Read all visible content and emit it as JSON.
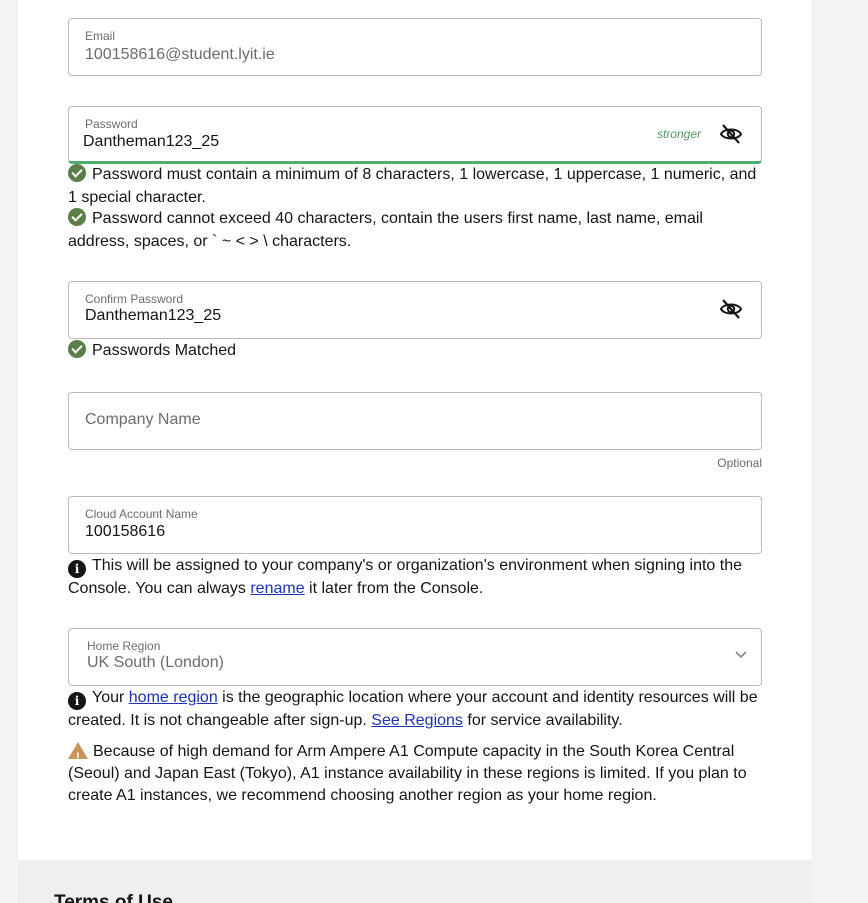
{
  "email": {
    "label": "Email",
    "value": "100158616@student.lyit.ie"
  },
  "password": {
    "label": "Password",
    "value": "Dantheman123_25",
    "strength": "stronger",
    "rule1": "Password must contain a minimum of 8 characters, 1 lowercase, 1 uppercase, 1 numeric, and 1 special character.",
    "rule2": "Password cannot exceed 40 characters, contain the users first name, last name, email address, spaces, or ` ~ < > \\ characters."
  },
  "confirm_password": {
    "label": "Confirm Password",
    "value": "Dantheman123_25",
    "match_text": "Passwords Matched"
  },
  "company": {
    "placeholder": "Company Name",
    "optional_text": "Optional"
  },
  "cloud_account": {
    "label": "Cloud Account Name",
    "value": "100158616",
    "info_before": "This will be assigned to your company's or organization's environment when signing into the Console. You can always ",
    "info_link": "rename",
    "info_after": " it later from the Console."
  },
  "home_region": {
    "label": "Home Region",
    "value": "UK South (London)",
    "info_prefix": "Your ",
    "info_link1": "home region",
    "info_mid": " is the geographic location where your account and identity resources will be created. It is not changeable after sign-up. ",
    "info_link2": "See Regions",
    "info_suffix": " for service availability.",
    "warning": "Because of high demand for Arm Ampere A1 Compute capacity in the South Korea Central (Seoul) and Japan East (Tokyo), A1 instance availability in these regions is limited. If you plan to create A1 instances, we recommend choosing another region as your home region."
  },
  "footer": {
    "terms_title": "Terms of Use"
  },
  "colors": {
    "success": "#5a7d4a",
    "strength": "#4c9a5f",
    "link": "#1c32b8",
    "warning": "#c9955a"
  },
  "icons": [
    "check-circle-icon",
    "eye-off-icon",
    "info-icon",
    "warning-icon",
    "chevron-down-icon"
  ]
}
